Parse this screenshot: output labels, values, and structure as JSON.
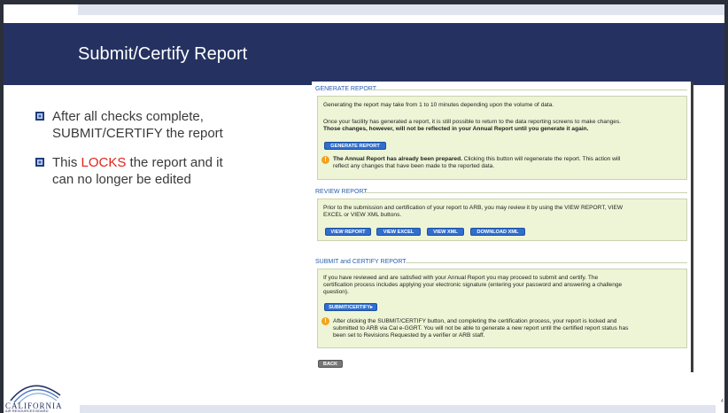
{
  "slide": {
    "title": "Submit/Certify Report",
    "bullets": [
      {
        "line1": "After all checks complete,",
        "line2": "SUBMIT/CERTIFY the report"
      },
      {
        "line1_pre": "This ",
        "line1_red": "LOCKS",
        "line1_post": " the report and it",
        "line2": "can no longer be edited"
      }
    ],
    "page_number": "4",
    "logo": {
      "name": "CALIFORNIA",
      "sub": "AIR RESOURCES BOARD"
    }
  },
  "generate": {
    "title": "GENERATE REPORT",
    "line1": "Generating the report may take from 1 to 10 minutes depending upon the volume of data.",
    "line2": "Once your facility has generated a report, it is still possible to return to the data reporting screens to make changes.",
    "line3": "Those changes, however, will not be reflected in your Annual Report until you generate it again.",
    "button": "GENERATE REPORT",
    "warn_bold": "The Annual Report has already been prepared.",
    "warn_rest": " Clicking this button will regenerate the report. This action will",
    "warn_line2": "reflect any changes that have been made to the reported data."
  },
  "review": {
    "title": "REVIEW REPORT",
    "line1": "Prior to the submission and certification of your report to ARB, you may review it by using the VIEW REPORT, VIEW",
    "line2": "EXCEL or VIEW XML buttons.",
    "buttons": [
      "VIEW REPORT",
      "VIEW EXCEL",
      "VIEW XML",
      "DOWNLOAD XML"
    ]
  },
  "submit": {
    "title": "SUBMIT and CERTIFY REPORT",
    "line1": "If you have reviewed and are satisfied with your Annual Report you may proceed to submit and certify. The",
    "line2": "certification process includes applying your electronic signature (entering your password and answering a challenge",
    "line3": "question).",
    "button": "SUBMIT/CERTIFY",
    "warn_line1": "After clicking the SUBMIT/CERTIFY button, and completing the certification process, your report is locked and",
    "warn_line2": "submitted to ARB via Cal e-GGRT. You will not be able to generate a new report until the certified report status has",
    "warn_line3": "been set to Revisions Requested by a verifier or ARB staff."
  },
  "back_button": "BACK"
}
